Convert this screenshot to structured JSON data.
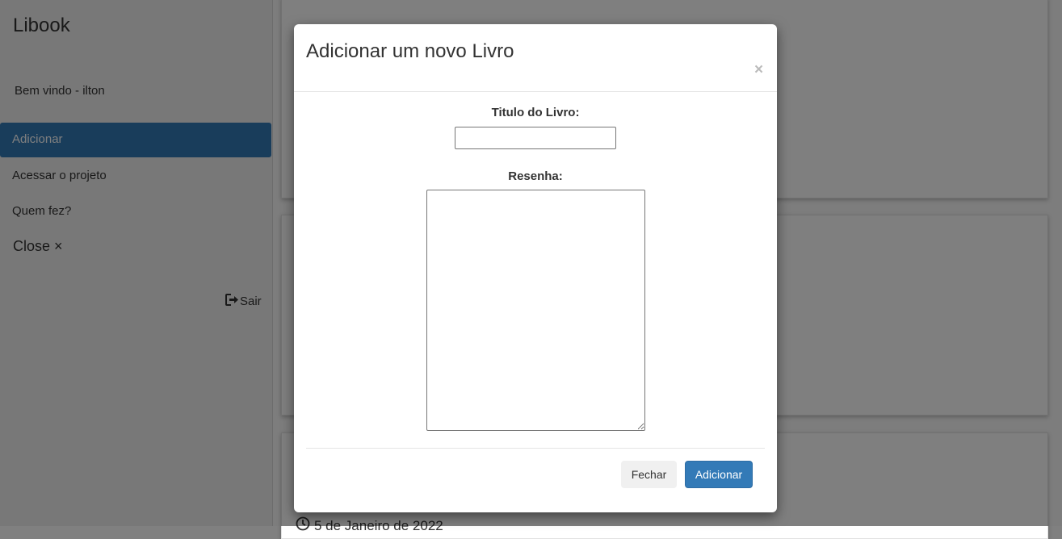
{
  "sidebar": {
    "brand": "Libook",
    "welcome": "Bem vindo - ilton",
    "items": [
      {
        "label": "Adicionar"
      },
      {
        "label": "Acessar o projeto"
      },
      {
        "label": "Quem fez?"
      }
    ],
    "close_label": "Close ×",
    "logout_label": "Sair"
  },
  "main": {
    "card_date": "5 de Janeiro de 2022"
  },
  "modal": {
    "title": "Adicionar um novo Livro",
    "close_symbol": "×",
    "title_label": "Titulo do Livro:",
    "title_value": "",
    "review_label": "Resenha:",
    "review_value": "",
    "cancel_label": "Fechar",
    "submit_label": "Adicionar"
  },
  "colors": {
    "primary": "#337ab7",
    "overlay": "rgba(0,0,0,0.5)"
  }
}
